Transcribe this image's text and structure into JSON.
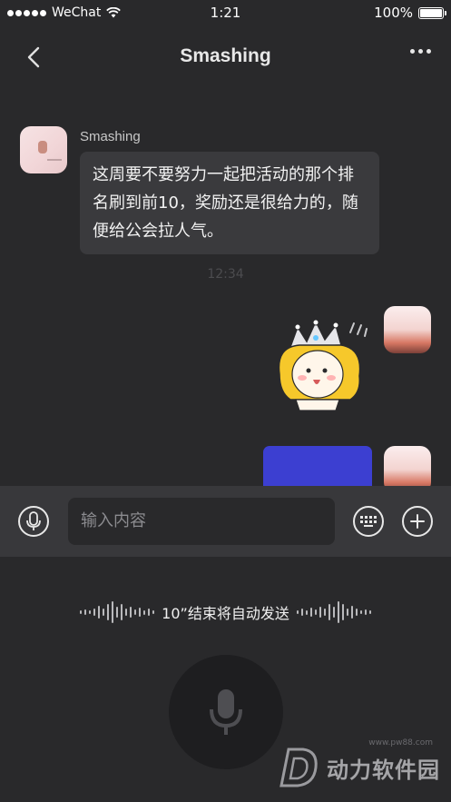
{
  "status_bar": {
    "carrier": "WeChat",
    "time": "1:21",
    "battery": "100%"
  },
  "nav": {
    "title": "Smashing"
  },
  "conversation": {
    "incoming": {
      "sender": "Smashing",
      "text": "这周要不要努力一起把活动的那个排名刷到前10，奖励还是很给力的，随便给公会拉人气。"
    },
    "timestamp": "12:34"
  },
  "input_bar": {
    "placeholder": "输入内容"
  },
  "voice_panel": {
    "countdown": "10”结束将自动发送"
  },
  "watermark": {
    "name": "动力软件园",
    "url": "www.pw88.com"
  },
  "colors": {
    "background": "#29292b",
    "bubble_incoming": "#3a3a3d",
    "bubble_outgoing": "#3c3fd1",
    "input_bar": "#38383b"
  },
  "icons": [
    "back-chevron-icon",
    "more-dots-icon",
    "microphone-icon",
    "keyboard-icon",
    "plus-icon"
  ]
}
